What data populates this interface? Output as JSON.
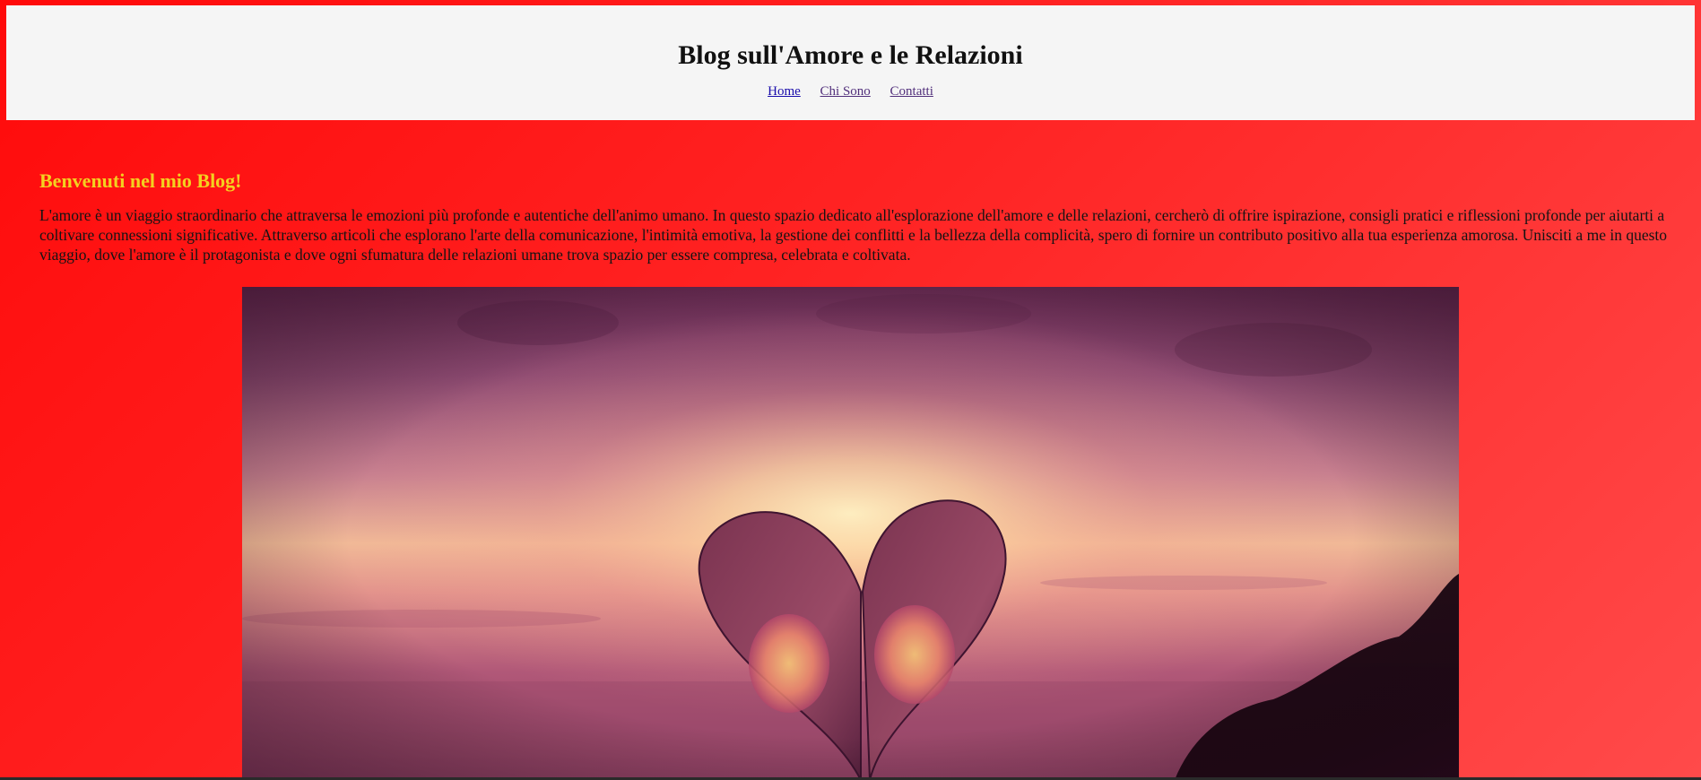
{
  "header": {
    "title": "Blog sull'Amore e le Relazioni",
    "nav": [
      {
        "label": "Home"
      },
      {
        "label": "Chi Sono"
      },
      {
        "label": "Contatti"
      }
    ]
  },
  "main": {
    "heading": "Benvenuti nel mio Blog!",
    "intro": "L'amore è un viaggio straordinario che attraversa le emozioni più profonde e autentiche dell'animo umano. In questo spazio dedicato all'esplorazione dell'amore e delle relazioni, cercherò di offrire ispirazione, consigli pratici e riflessioni profonde per aiutarti a coltivare connessioni significative. Attraverso articoli che esplorano l'arte della comunicazione, l'intimità emotiva, la gestione dei conflitti e la bellezza della complicità, spero di fornire un contributo positivo alla tua esperienza amorosa. Unisciti a me in questo viaggio, dove l'amore è il protagonista e dove ogni sfumatura delle relazioni umane trova spazio per essere compresa, celebrata e coltivata."
  },
  "hero_image": {
    "icon": "paper-heart-sunset-photo"
  },
  "colors": {
    "background_start": "#ff0a0a",
    "background_end": "#ff4a4a",
    "header_background": "#f5f5f5",
    "heading_color": "#f4d020",
    "link_color": "#1a0dab",
    "visited_link_color": "#52307c"
  }
}
